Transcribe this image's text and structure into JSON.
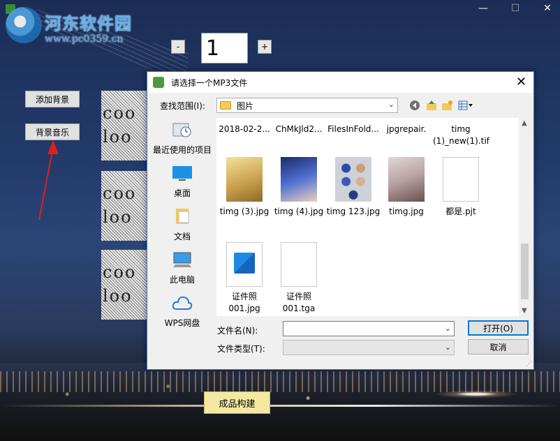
{
  "window": {
    "controls": [
      "—",
      "☐",
      "✕"
    ]
  },
  "watermark": {
    "title": "河东软件园",
    "url": "www.pc0359.cn"
  },
  "stepper": {
    "minus": "-",
    "plus": "+",
    "value": "1"
  },
  "side_buttons": {
    "add_background": "添加背景",
    "background_music": "背景音乐"
  },
  "thumbnails": [
    {
      "line1": "coo",
      "line2": "loo"
    },
    {
      "line1": "coo",
      "line2": "loo"
    },
    {
      "line1": "coo",
      "line2": "loo"
    }
  ],
  "build_button": "成品构建",
  "dialog": {
    "title": "请选择一个MP3文件",
    "close": "✕",
    "look_in_label": "查找范围(I):",
    "look_in_value": "图片",
    "places": [
      "最近使用的项目",
      "桌面",
      "文档",
      "此电脑",
      "WPS网盘"
    ],
    "files_row0": [
      "2018-02-2...",
      "ChMkJld2...",
      "FilesInFold...",
      "jpgrepair.",
      "timg (1)_new(1).tif"
    ],
    "files_row1": [
      "timg (3).jpg",
      "timg (4).jpg",
      "timg 123.jpg",
      "timg.jpg",
      "都是.pjt"
    ],
    "files_row2": [
      "证件照 001.jpg",
      "证件照 001.tga"
    ],
    "filename_label": "文件名(N):",
    "filename_value": "",
    "filetype_label": "文件类型(T):",
    "filetype_value": "",
    "open_button": "打开(O)",
    "cancel_button": "取消"
  }
}
